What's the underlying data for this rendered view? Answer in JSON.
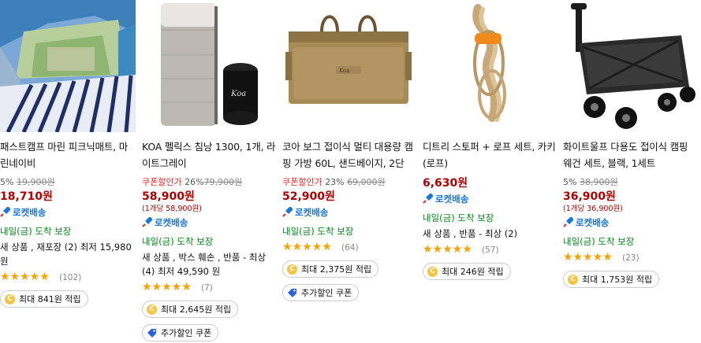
{
  "products": [
    {
      "name": "패스트캠프 마린 피크닉매트, 마린네이비",
      "discount": "5%",
      "original_price": "19,900원",
      "price": "18,710원",
      "rocket": "로켓배송",
      "delivery": "내일(금) 도착 보장",
      "other_sellers": "새 상품 , 재포장 (2) 최저 15,980 원",
      "rating": 4.5,
      "review_count": "(102)",
      "badges": [
        {
          "type": "coin",
          "text": "최대 841원 적립"
        }
      ]
    },
    {
      "name": "KOA 펠릭스 침낭 1300, 1개, 라이트그레이",
      "coupon": "쿠폰할인가",
      "discount": "26%",
      "original_price": "79,900원",
      "price": "58,900원",
      "unit_price": "(1개당 58,900원)",
      "rocket": "로켓배송",
      "delivery": "내일(금) 도착 보장",
      "other_sellers": "새 상품 , 박스 훼손 , 반품 - 최상 (4) 최저 49,590 원",
      "rating": 5,
      "review_count": "(7)",
      "badges": [
        {
          "type": "coin",
          "text": "최대 2,645원 적립"
        },
        {
          "type": "tag",
          "text": "추가할인 쿠폰"
        }
      ]
    },
    {
      "name": "코아 보그 접이식 멀티 대용량 캠핑 가방 60L, 샌드베이지, 2단",
      "coupon": "쿠폰할인가",
      "discount": "23%",
      "original_price": "69,000원",
      "price": "52,900원",
      "rocket": "로켓배송",
      "delivery": "내일(금) 도착 보장",
      "rating": 5,
      "review_count": "(64)",
      "badges": [
        {
          "type": "coin",
          "text": "최대 2,375원 적립"
        },
        {
          "type": "tag",
          "text": "추가할인 쿠폰"
        }
      ]
    },
    {
      "name": "디트리 스토퍼 + 로프 세트, 카키(로프)",
      "price": "6,630원",
      "rocket": "로켓배송",
      "delivery": "내일(금) 도착 보장",
      "other_sellers": "새 상품 , 반품 - 최상 (2)",
      "rating": 4.5,
      "review_count": "(57)",
      "badges": [
        {
          "type": "coin",
          "text": "최대 246원 적립"
        }
      ]
    },
    {
      "name": "화이트울프 다용도 접이식 캠핑 웨건 세트, 블랙, 1세트",
      "discount": "5%",
      "original_price": "38,900원",
      "price": "36,900원",
      "unit_price": "(1개당 36,900원)",
      "rocket": "로켓배송",
      "delivery": "내일(금) 도착 보장",
      "rating": 5,
      "review_count": "(23)",
      "badges": [
        {
          "type": "coin",
          "text": "최대 1,753원 적립"
        }
      ]
    }
  ],
  "colors": {
    "price": "#ae0000",
    "rocket": "#1a77d3",
    "delivery": "#00891a",
    "star": "#f7a400",
    "coupon": "#e52528"
  },
  "icons": [
    "tent-photo",
    "sleeping-bag-photo",
    "camping-bag-photo",
    "rope-photo",
    "wagon-photo",
    "rocket-icon",
    "coin-icon",
    "coupon-tag-icon",
    "star-icon"
  ]
}
